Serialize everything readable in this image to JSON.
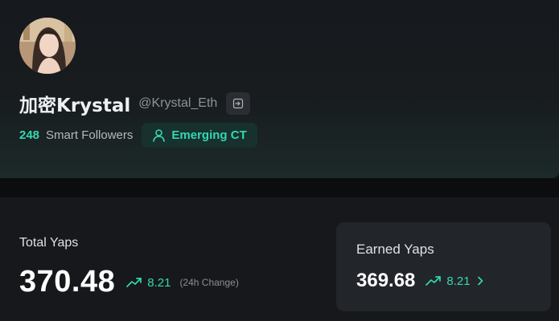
{
  "profile": {
    "display_name": "加密Krystal",
    "handle": "@Krystal_Eth",
    "smart_followers_count": "248",
    "smart_followers_label": "Smart Followers",
    "badge_label": "Emerging CT"
  },
  "total_yaps": {
    "title": "Total Yaps",
    "value": "370.48",
    "change": "8.21",
    "change_note": "(24h Change)"
  },
  "earned_yaps": {
    "title": "Earned Yaps",
    "value": "369.68",
    "change": "8.21"
  },
  "colors": {
    "accent": "#34d8b0",
    "background": "#0f1114",
    "card": "#22252a"
  },
  "icons": {
    "avatar": "profile-photo",
    "copy": "copy-icon",
    "badge": "user-icon",
    "trend": "trend-up-icon",
    "chevron": "chevron-right-icon"
  }
}
